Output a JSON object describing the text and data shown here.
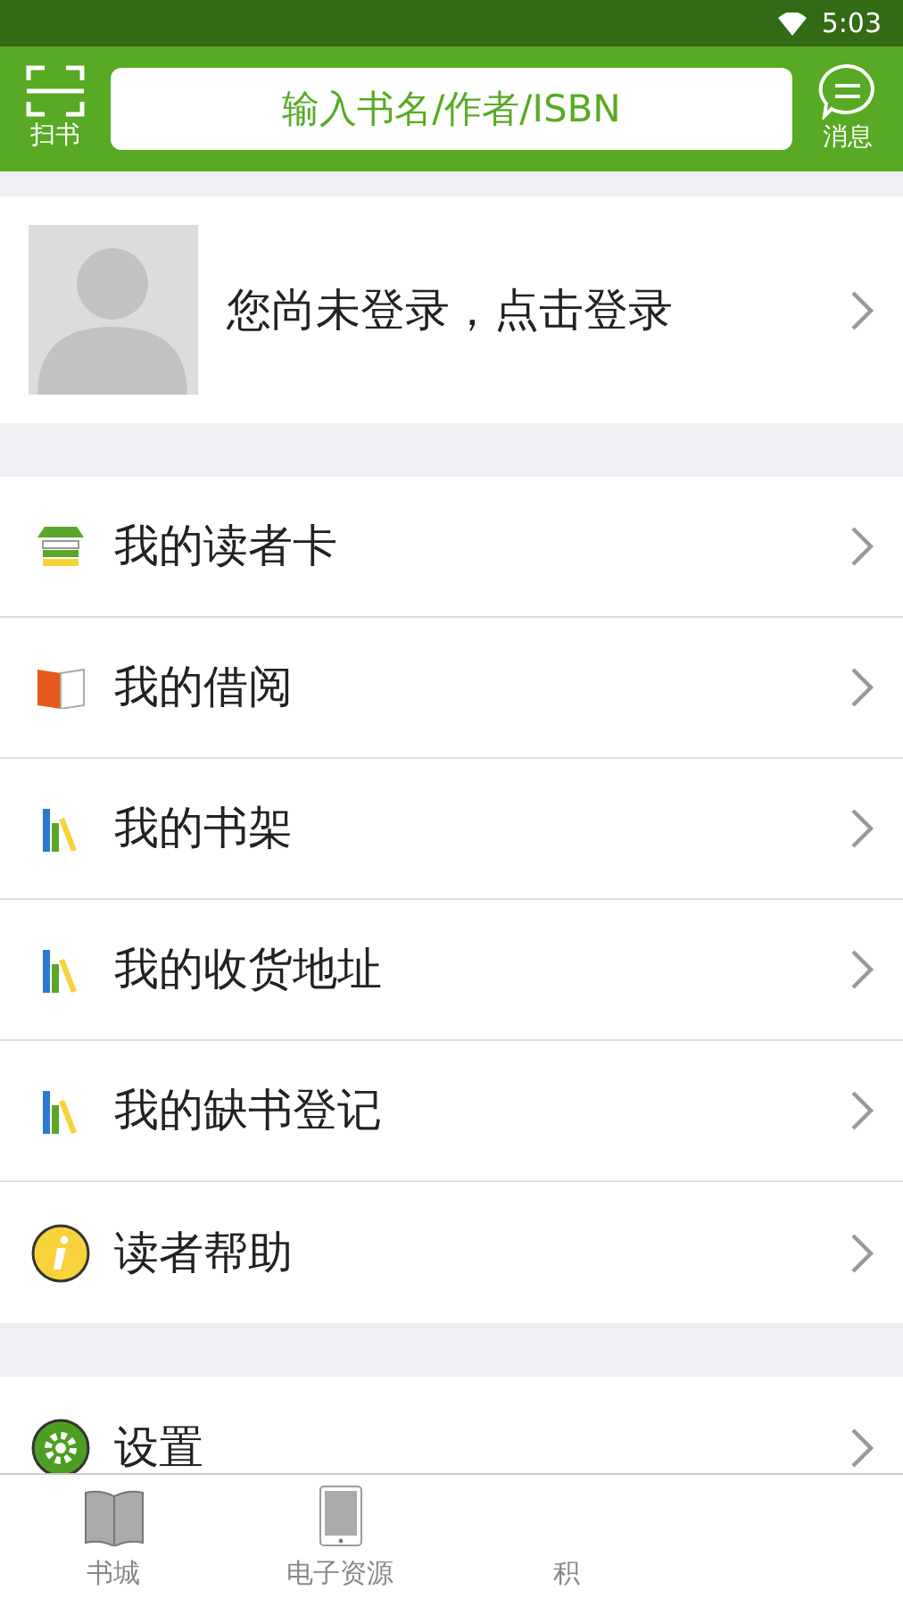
{
  "status_bar": {
    "time": "5:03"
  },
  "header": {
    "scan_label": "扫书",
    "search": {
      "placeholder": "输入书名/作者/ISBN"
    },
    "message_label": "消息"
  },
  "login": {
    "text": "您尚未登录，点击登录"
  },
  "menu_groups": [
    [
      {
        "label": "我的读者卡",
        "kind": "card"
      },
      {
        "label": "我的借阅",
        "kind": "borrow"
      },
      {
        "label": "我的书架",
        "kind": "shelf"
      },
      {
        "label": "我的收货地址",
        "kind": "shelf"
      },
      {
        "label": "我的缺书登记",
        "kind": "shelf"
      },
      {
        "label": "读者帮助",
        "kind": "help"
      }
    ],
    [
      {
        "label": "设置",
        "kind": "settings"
      }
    ]
  ],
  "bottom_nav": [
    {
      "label": "书城",
      "kind": "store"
    },
    {
      "label": "电子资源",
      "kind": "ebook"
    },
    {
      "label": "积",
      "kind": "other"
    }
  ]
}
